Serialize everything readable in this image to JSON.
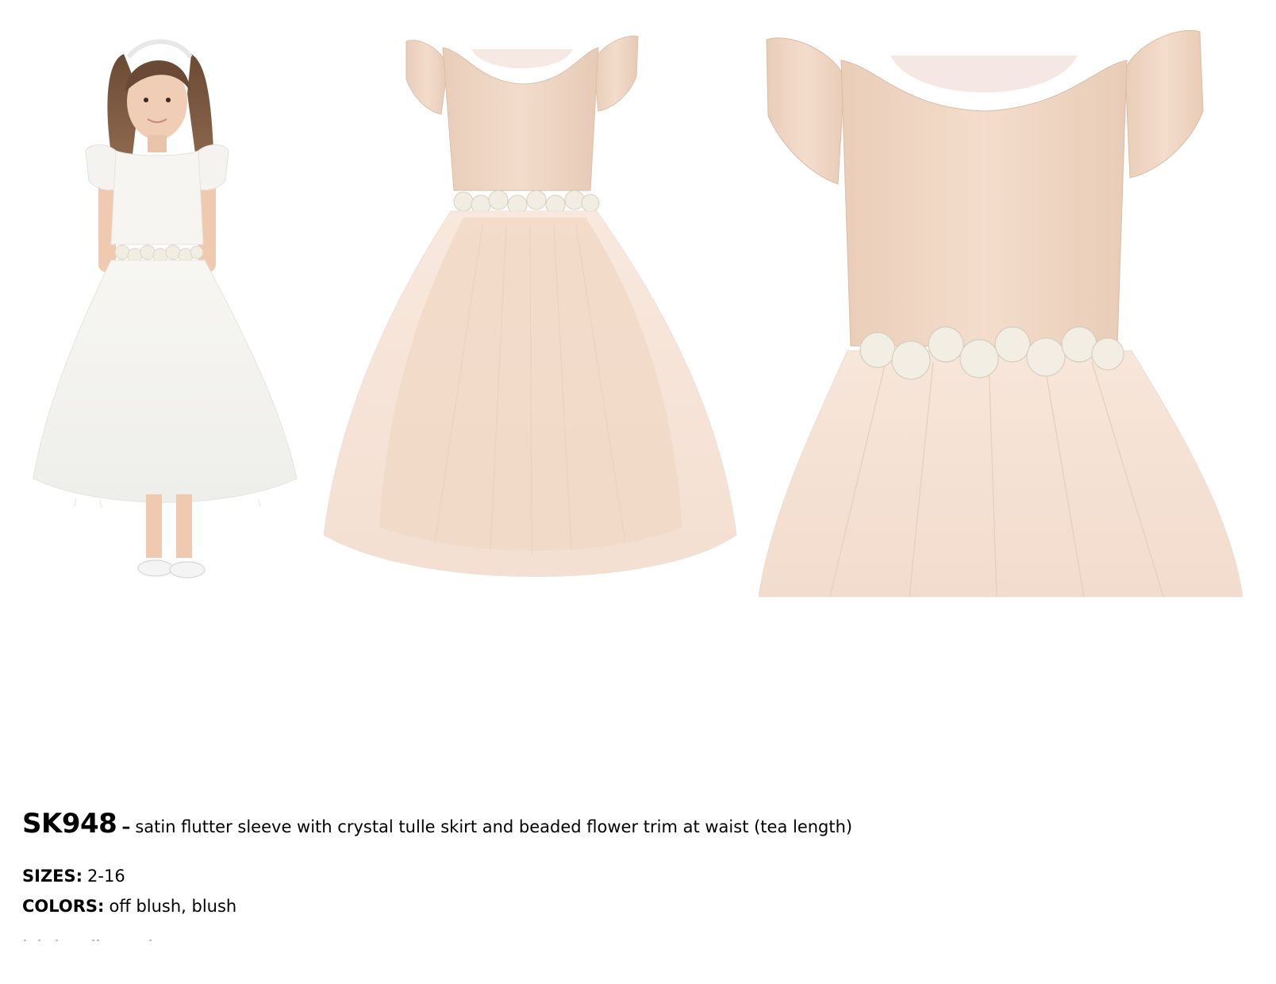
{
  "product": {
    "sku": "SK948",
    "separator": "–",
    "description": "satin flutter sleeve with crystal tulle skirt and beaded flower trim at waist (tea length)"
  },
  "specs": {
    "sizes_label": "SIZES:",
    "sizes_value": "2-16",
    "colors_label": "COLORS:",
    "colors_value": "off blush, blush"
  },
  "colors": {
    "background": "#ffffff",
    "off_white_dress": "#f6f5f1",
    "blush_satin": "#f0d9c7",
    "blush_tulle": "#f6e3d7",
    "lace_trim": "#f3efe6"
  }
}
